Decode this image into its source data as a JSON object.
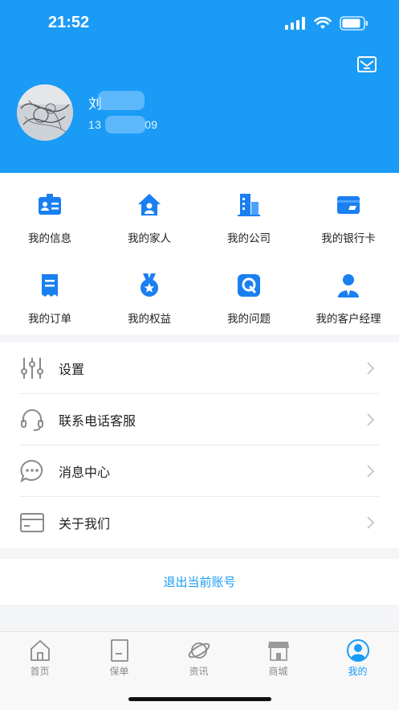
{
  "status_bar": {
    "time": "21:52"
  },
  "profile": {
    "name": "刘",
    "phone_prefix": "13",
    "phone_suffix": "09"
  },
  "grid": [
    {
      "label": "我的信息",
      "icon": "id-card-icon"
    },
    {
      "label": "我的家人",
      "icon": "house-person-icon"
    },
    {
      "label": "我的公司",
      "icon": "building-icon"
    },
    {
      "label": "我的银行卡",
      "icon": "bank-card-icon"
    },
    {
      "label": "我的订单",
      "icon": "receipt-icon"
    },
    {
      "label": "我的权益",
      "icon": "medal-icon"
    },
    {
      "label": "我的问题",
      "icon": "question-q-icon"
    },
    {
      "label": "我的客户经理",
      "icon": "manager-icon"
    }
  ],
  "menu": [
    {
      "label": "设置",
      "icon": "sliders-icon"
    },
    {
      "label": "联系电话客服",
      "icon": "headset-icon"
    },
    {
      "label": "消息中心",
      "icon": "chat-bubble-icon"
    },
    {
      "label": "关于我们",
      "icon": "card-icon"
    }
  ],
  "logout_label": "退出当前账号",
  "tabs": [
    {
      "label": "首页",
      "icon": "home-icon"
    },
    {
      "label": "保单",
      "icon": "document-icon"
    },
    {
      "label": "资讯",
      "icon": "planet-icon"
    },
    {
      "label": "商城",
      "icon": "store-icon"
    },
    {
      "label": "我的",
      "icon": "user-icon"
    }
  ],
  "colors": {
    "brand": "#1a9bf6",
    "icon_blue": "#1a7ff0",
    "gray_icon": "#8a8a8a"
  }
}
